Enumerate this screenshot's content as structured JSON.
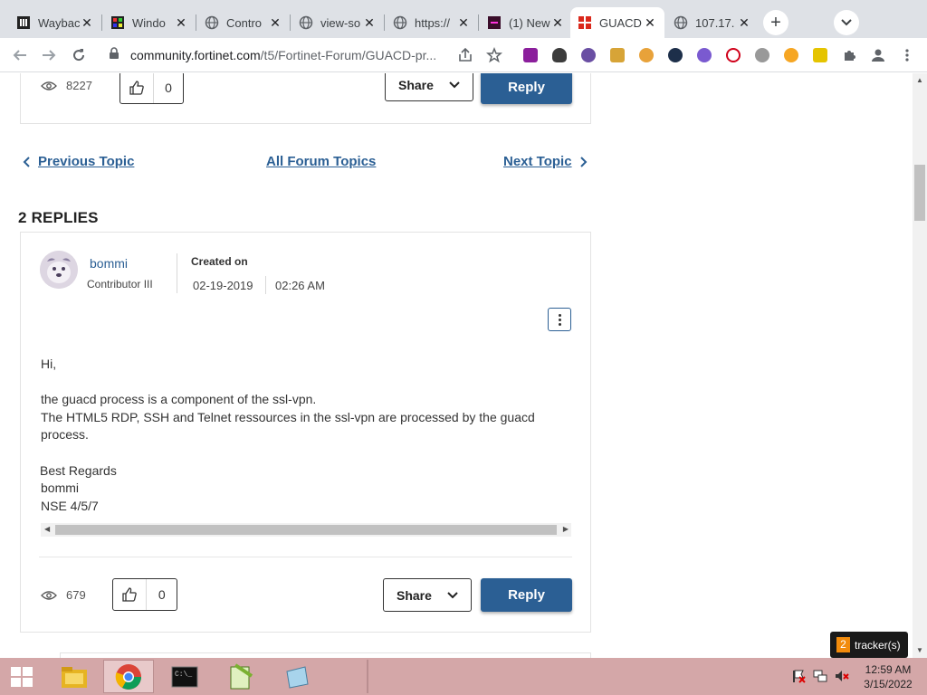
{
  "tabs": [
    {
      "title": "Wayback",
      "icon": "wayback-icon"
    },
    {
      "title": "Windo",
      "icon": "windows-icon"
    },
    {
      "title": "Contro",
      "icon": "globe-icon"
    },
    {
      "title": "view-so",
      "icon": "globe-icon"
    },
    {
      "title": "https://",
      "icon": "globe-icon"
    },
    {
      "title": "(1) New",
      "icon": "app-icon"
    },
    {
      "title": "GUACD",
      "icon": "fortinet-icon"
    },
    {
      "title": "107.17.",
      "icon": "globe-icon"
    }
  ],
  "omnibox": {
    "host": "community.fortinet.com",
    "path": "/t5/Fortinet-Forum/GUACD-pr..."
  },
  "top_post": {
    "views": "8227",
    "kudos": "0",
    "share_label": "Share",
    "reply_label": "Reply"
  },
  "topic_nav": {
    "previous": "Previous Topic",
    "all": "All Forum Topics",
    "next": "Next Topic"
  },
  "replies_heading": "2 REPLIES",
  "reply": {
    "author": "bommi",
    "rank": "Contributor III",
    "created_label": "Created on",
    "date": "02-19-2019",
    "time": "02:26 AM",
    "body": [
      "Hi,",
      "the guacd process is a component of the ssl-vpn.",
      "The HTML5 RDP, SSH and Telnet ressources in the ssl-vpn are processed by the guacd",
      "process.",
      "Best Regards",
      "bommi",
      "NSE 4/5/7"
    ],
    "views": "679",
    "kudos": "0",
    "share_label": "Share",
    "reply_label": "Reply"
  },
  "tracker": {
    "count": "2",
    "label": "tracker(s)"
  },
  "clock": {
    "time": "12:59 AM",
    "date": "3/15/2022"
  },
  "colors": {
    "accent": "#2b5f94",
    "taskbar": "#d4a7a8",
    "tracker_badge": "#f28b0c"
  }
}
